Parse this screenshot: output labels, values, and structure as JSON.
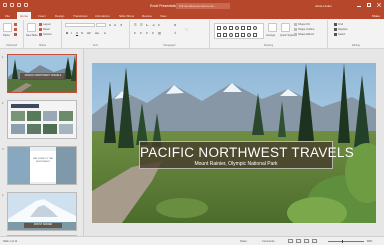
{
  "window": {
    "title": "Excel Presentation - PowerPoint",
    "tell_me": "Tell me what you want to do...",
    "user": "Jamie Linden",
    "share": "Share"
  },
  "tabs": [
    "File",
    "Home",
    "Insert",
    "Design",
    "Transitions",
    "Animations",
    "Slide Show",
    "Review",
    "View"
  ],
  "active_tab": "Home",
  "ribbon": {
    "clipboard": {
      "paste": "Paste",
      "label": "Clipboard"
    },
    "slides": {
      "new_slide": "New Slide",
      "layout": "Layout",
      "reset": "Reset",
      "section": "Section",
      "label": "Slides"
    },
    "font": {
      "label": "Font"
    },
    "paragraph": {
      "label": "Paragraph"
    },
    "drawing": {
      "arrange": "Arrange",
      "quick_styles": "Quick Styles",
      "shape_fill": "Shape Fill",
      "shape_outline": "Shape Outline",
      "shape_effects": "Shape Effects",
      "label": "Drawing"
    },
    "editing": {
      "find": "Find",
      "replace": "Replace",
      "select": "Select",
      "label": "Editing"
    }
  },
  "thumbnails": [
    {
      "num": "1",
      "label": "PACIFIC NORTHWEST TRAVELS"
    },
    {
      "num": "2",
      "label": ""
    },
    {
      "num": "3",
      "label": "WELCOME TO THE NORTHWEST"
    },
    {
      "num": "4",
      "label": "MOUNT RAINIER"
    }
  ],
  "slide": {
    "title": "PACIFIC NORTHWEST TRAVELS",
    "subtitle": "Mount Rainier, Olympic National Park"
  },
  "status": {
    "slide_count": "Slide 1 of 11",
    "notes": "Notes",
    "comments": "Comments",
    "zoom": "89%"
  },
  "colors": {
    "accent": "#b7472a",
    "selection": "#c4503a"
  }
}
